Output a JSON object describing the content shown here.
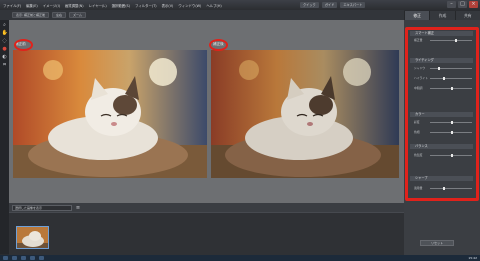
{
  "menu": {
    "items": [
      "ファイル(F)",
      "編集(E)",
      "イメージ(I)",
      "画質調整(N)",
      "レイヤー(L)",
      "選択範囲(S)",
      "フィルター(T)",
      "表示(V)",
      "ウィンドウ(W)",
      "ヘルプ(H)"
    ],
    "mode_chips": [
      "クイック",
      "ガイド",
      "エキスパート"
    ]
  },
  "subbar": {
    "chips": [
      "表示: 補正前と補正後",
      "左右",
      "ズーム"
    ]
  },
  "panel_tabs": [
    "修正",
    "作成",
    "共有"
  ],
  "canvas": {
    "before_label": "補正前",
    "after_label": "補正後"
  },
  "bin": {
    "select_value": "選択した画像を表示"
  },
  "panel": {
    "sections": [
      {
        "title": "スマート補正",
        "rows": [
          "補正量"
        ]
      },
      {
        "title": "ライティング",
        "rows": [
          "シャドウ",
          "ハイライト",
          "中間調"
        ]
      },
      {
        "title": "カラー",
        "rows": [
          "彩度",
          "色相"
        ]
      },
      {
        "title": "バランス",
        "rows": [
          "色温度"
        ]
      },
      {
        "title": "シャープ",
        "rows": [
          "適用量"
        ]
      }
    ],
    "reset_label": "リセット"
  },
  "taskbar": {
    "clock": "15:42"
  },
  "colors": {
    "highlight_red": "#e0221b",
    "accent_blue": "#6fa0d8"
  }
}
